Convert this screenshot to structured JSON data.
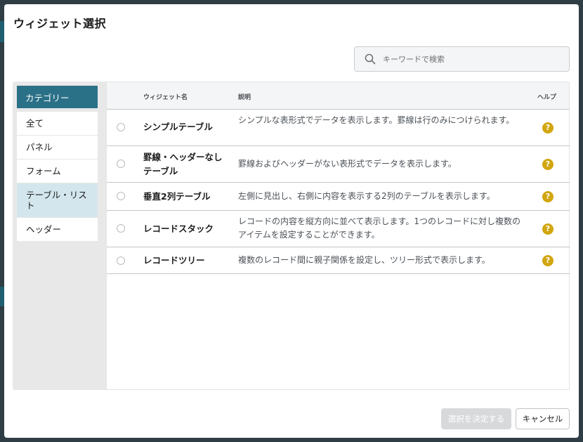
{
  "dialog": {
    "title": "ウィジェット選択"
  },
  "search": {
    "placeholder": "キーワードで検索",
    "value": ""
  },
  "categories": {
    "header": "カテゴリー",
    "items": [
      {
        "label": "全て",
        "selected": false
      },
      {
        "label": "パネル",
        "selected": false
      },
      {
        "label": "フォーム",
        "selected": false
      },
      {
        "label": "テーブル・リスト",
        "selected": true
      },
      {
        "label": "ヘッダー",
        "selected": false
      }
    ]
  },
  "table": {
    "columns": {
      "name": "ウィジェット名",
      "description": "説明",
      "help": "ヘルプ"
    },
    "rows": [
      {
        "name": "シンプルテーブル",
        "description": "シンプルな表形式でデータを表示します。罫線は行のみにつけられます。",
        "help_icon": "question-circle-icon"
      },
      {
        "name": "罫線・ヘッダーなしテーブル",
        "description": "罫線およびヘッダーがない表形式でデータを表示します。",
        "help_icon": "question-circle-icon"
      },
      {
        "name": "垂直2列テーブル",
        "description": "左側に見出し、右側に内容を表示する2列のテーブルを表示します。",
        "help_icon": "question-circle-icon"
      },
      {
        "name": "レコードスタック",
        "description": "レコードの内容を縦方向に並べて表示します。1つのレコードに対し複数のアイテムを設定することができます。",
        "help_icon": "question-circle-icon"
      },
      {
        "name": "レコードツリー",
        "description": "複数のレコード間に親子関係を設定し、ツリー形式で表示します。",
        "help_icon": "question-circle-icon"
      }
    ]
  },
  "footer": {
    "confirm_label": "選択を決定する",
    "cancel_label": "キャンセル"
  },
  "colors": {
    "accent": "#2a7087",
    "selected_category_bg": "#d3e6ed",
    "help_icon": "#d2a60f",
    "disabled_button": "#d7d9db"
  }
}
